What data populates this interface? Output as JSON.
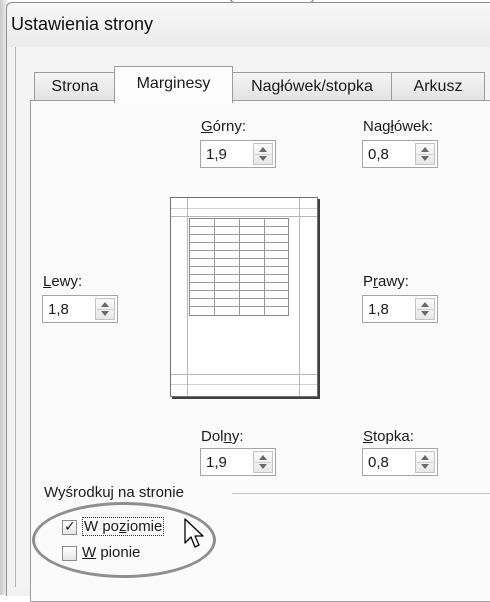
{
  "dialog": {
    "title": "Ustawienia strony"
  },
  "tabs": [
    {
      "label": "Strona",
      "active": false
    },
    {
      "label": "Marginesy",
      "active": true
    },
    {
      "label": "Nagłówek/stopka",
      "active": false
    },
    {
      "label": "Arkusz",
      "active": false
    }
  ],
  "margins": {
    "top": {
      "label_pre": "",
      "label_key": "G",
      "label_post": "órny:",
      "value": "1,9"
    },
    "header": {
      "label_pre": "Nag",
      "label_key": "ł",
      "label_post": "ówek:",
      "value": "0,8"
    },
    "left": {
      "label_pre": "",
      "label_key": "L",
      "label_post": "ewy:",
      "value": "1,8"
    },
    "right": {
      "label_pre": "P",
      "label_key": "r",
      "label_post": "awy:",
      "value": "1,8"
    },
    "bottom": {
      "label_pre": "Dol",
      "label_key": "n",
      "label_post": "y:",
      "value": "1,9"
    },
    "footer": {
      "label_pre": "",
      "label_key": "S",
      "label_post": "topka:",
      "value": "0,8"
    }
  },
  "center_group": {
    "title": "Wyśrodkuj na stronie",
    "horizontal": {
      "label_pre": "W po",
      "label_key": "z",
      "label_post": "iomie",
      "checked": true
    },
    "vertical": {
      "label_pre": "",
      "label_key": "W",
      "label_post": " pionie",
      "checked": false
    }
  },
  "icons": {
    "spinner": "spin-arrows-icon",
    "cursor": "mouse-pointer-icon",
    "check": "checkmark-icon"
  },
  "colors": {
    "panel": "#fbfbfb",
    "highlight": "#8e8e8e"
  }
}
